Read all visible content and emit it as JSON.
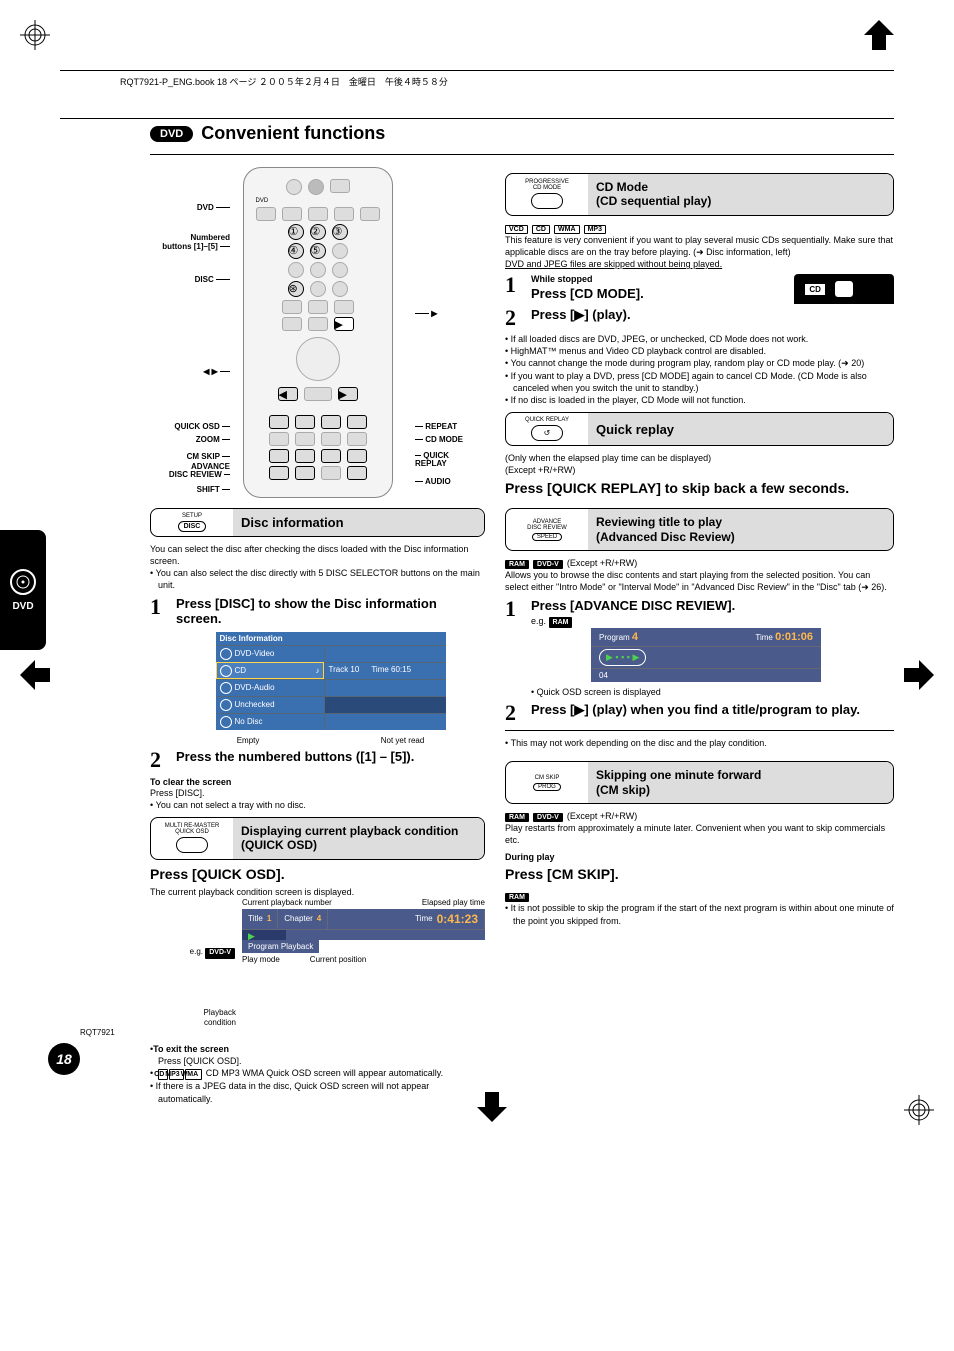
{
  "header": {
    "book_line": "RQT7921-P_ENG.book  18 ページ  ２００５年２月４日　金曜日　午後４時５８分"
  },
  "title": {
    "dvd_badge": "DVD",
    "text": "Convenient functions"
  },
  "side_tab": {
    "label": "DVD"
  },
  "remote_callouts": {
    "dvd": "DVD",
    "numbered": "Numbered\nbuttons [1]–[5]",
    "disc": "DISC",
    "left_right": "◀ ▶",
    "quick_osd": "QUICK OSD",
    "zoom": "ZOOM",
    "cm_skip": "CM SKIP",
    "advance_disc_review": "ADVANCE\nDISC REVIEW",
    "shift": "SHIFT",
    "play": "▶",
    "repeat": "REPEAT",
    "cd_mode": "CD MODE",
    "quick_replay": "QUICK\nREPLAY",
    "audio": "AUDIO"
  },
  "remote_button_labels": {
    "row7_1": "QUICK OSD",
    "row7_2": "ZOOM",
    "row7_3": "REPEAT",
    "row7_4": "CD MODE",
    "row8_1": "CM SKIP",
    "row8_2": "ADVANCE DISC REVIEW",
    "row8_3": "QUICK REPLAY",
    "row8_4": "AUDIO",
    "row9_1": "PROG",
    "row9_2": "SPEED",
    "row9_3": "",
    "row9_4": "SHIFT",
    "dvd_row": "DVD"
  },
  "disc_info": {
    "section_btn_top": "SETUP",
    "section_btn_label": "DISC",
    "section_title": "Disc information",
    "intro1": "You can select the disc after checking the discs loaded with the Disc information screen.",
    "intro_bullet": "You can also select the disc directly with 5 DISC SELECTOR buttons on the main unit.",
    "step1": "Press [DISC] to show the Disc information screen.",
    "table": {
      "header": "Disc Information",
      "rows": [
        {
          "label": "DVD-Video",
          "sel": false
        },
        {
          "label": "CD",
          "sel": true,
          "track": "Track 10",
          "time": "Time 60:15"
        },
        {
          "label": "DVD-Audio",
          "sel": false
        },
        {
          "label": "Unchecked",
          "sel": false
        },
        {
          "label": "No Disc",
          "sel": false
        }
      ],
      "caption_left": "Empty",
      "caption_right": "Not yet read"
    },
    "step2": "Press the numbered buttons ([1] – [5]).",
    "clear_heading": "To clear the screen",
    "clear_text": "Press [DISC].",
    "clear_bullet": "You can not select a tray with no disc."
  },
  "quick_osd": {
    "section_btn_top": "MULTI RE-MASTER\nQUICK OSD",
    "section_title": "Displaying current playback condition (QUICK OSD)",
    "press": "Press [QUICK OSD].",
    "desc": "The current playback condition screen is displayed.",
    "eg": "e.g.",
    "badge": "DVD-V",
    "label_num": "Current playback number",
    "label_time": "Elapsed play time",
    "label_playback": "Playback\ncondition",
    "bar": {
      "title_label": "Title",
      "title_val": "1",
      "chapter_label": "Chapter",
      "chapter_val": "4",
      "time_label": "Time",
      "time_val": "0:41:23",
      "mode": "Program Playback"
    },
    "caption_left": "Play mode",
    "caption_right": "Current position",
    "exit_heading": "To exit the screen",
    "exit_text": "Press [QUICK OSD].",
    "bullets": [
      "CD MP3 WMA Quick OSD screen will appear automatically.",
      "If there is a JPEG data in the disc, Quick OSD screen will not appear automatically."
    ],
    "bullet_badges": [
      "CD",
      "MP3",
      "WMA"
    ]
  },
  "cd_mode": {
    "section_btn_top": "PROGRESSIVE\nCD MODE",
    "section_title_line1": "CD Mode",
    "section_title_line2": "(CD sequential play)",
    "badges": [
      "VCD",
      "CD",
      "WMA",
      "MP3"
    ],
    "desc": "This feature is very convenient if you want to play several music CDs sequentially. Make sure that applicable discs are on the tray before playing. (➜ Disc information, left)",
    "desc_underline": "DVD and JPEG files are skipped without being played.",
    "step1_sub": "While stopped",
    "step1": "Press [CD MODE].",
    "step1_badge": "CD",
    "step2": "Press [▶] (play).",
    "bullets": [
      "If all loaded discs are DVD, JPEG, or unchecked, CD Mode does not work.",
      "HighMAT™ menus and Video CD playback control are disabled.",
      "You cannot change the mode during program play, random play or CD mode play. (➜ 20)",
      "If you want to play a DVD, press [CD MODE] again to cancel CD Mode. (CD Mode is also canceled when you switch the unit to standby.)",
      "If no disc is loaded in the player, CD Mode will not function."
    ]
  },
  "quick_replay": {
    "section_btn_top": "QUICK REPLAY",
    "section_title": "Quick replay",
    "note1": "(Only when the elapsed play time can be displayed)",
    "note2": "(Except +R/+RW)",
    "press": "Press [QUICK REPLAY] to skip back a few seconds."
  },
  "adr": {
    "section_btn_top": "ADVANCE\nDISC REVIEW",
    "section_btn_label": "SPEED",
    "section_title_line1": "Reviewing title to play",
    "section_title_line2": "(Advanced Disc Review)",
    "badges": [
      "RAM",
      "DVD-V"
    ],
    "badges_note": "(Except +R/+RW)",
    "desc": "Allows you to browse the disc contents and start playing from the selected position. You can select either \"Intro Mode\" or \"Interval Mode\" in \"Advanced Disc Review\" in the \"Disc\" tab (➜ 26).",
    "step1": "Press [ADVANCE DISC REVIEW].",
    "eg": "e.g.",
    "eg_badge": "RAM",
    "bar": {
      "prog_label": "Program",
      "prog_val": "4",
      "time_label": "Time",
      "time_val": "0:01:06",
      "bottom": "04"
    },
    "bullet1": "Quick OSD screen is displayed",
    "step2": "Press [▶] (play) when you find a title/program to play.",
    "note": "This may not work depending on the disc and the play condition."
  },
  "cm_skip": {
    "section_btn_top": "CM SKIP",
    "section_btn_label": "PROG",
    "section_title_line1": "Skipping one minute forward",
    "section_title_line2": "(CM skip)",
    "badges": [
      "RAM",
      "DVD-V"
    ],
    "badges_note": "(Except +R/+RW)",
    "desc": "Play restarts from approximately a minute later. Convenient when you want to skip commercials etc.",
    "during": "During play",
    "press": "Press [CM SKIP].",
    "ram_badge": "RAM",
    "bullet": "It is not possible to skip the program if the start of the next program is within about one minute of the point you skipped from."
  },
  "footer": {
    "code": "RQT7921",
    "page": "18"
  }
}
